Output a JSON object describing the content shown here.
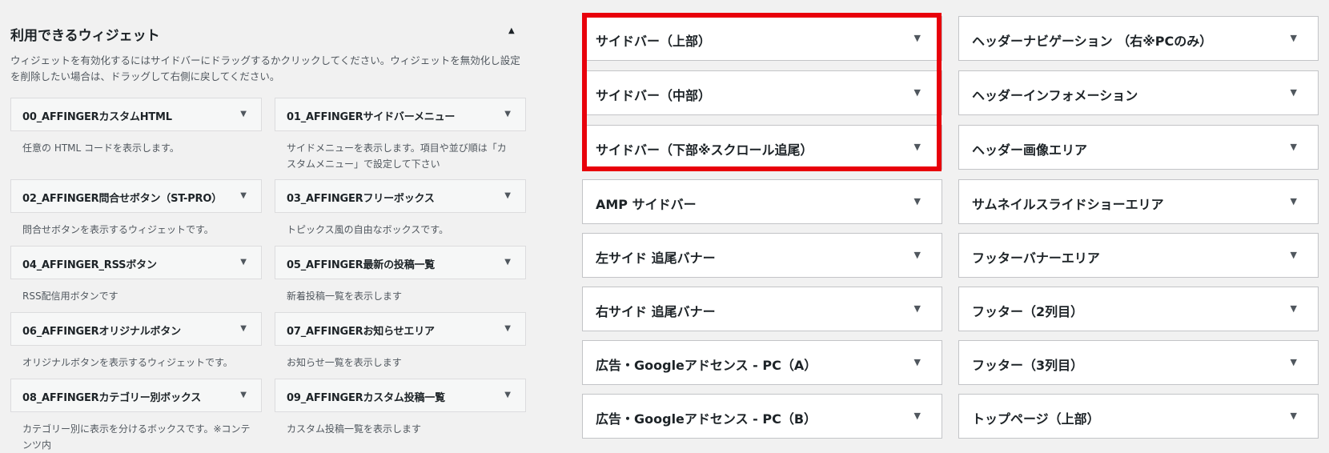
{
  "available": {
    "title": "利用できるウィジェット",
    "toggle": "▲",
    "description": "ウィジェットを有効化するにはサイドバーにドラッグするかクリックしてください。ウィジェットを無効化し設定を削除したい場合は、ドラッグして右側に戻してください。",
    "widgets": [
      {
        "label": "00_AFFINGERカスタムHTML",
        "desc": "任意の HTML コードを表示します。"
      },
      {
        "label": "01_AFFINGERサイドバーメニュー",
        "desc": "サイドメニューを表示します。項目や並び順は「カスタムメニュー」で設定して下さい"
      },
      {
        "label": "02_AFFINGER問合せボタン（ST-PRO）",
        "desc": "問合せボタンを表示するウィジェットです。"
      },
      {
        "label": "03_AFFINGERフリーボックス",
        "desc": "トピックス風の自由なボックスです。"
      },
      {
        "label": "04_AFFINGER_RSSボタン",
        "desc": "RSS配信用ボタンです"
      },
      {
        "label": "05_AFFINGER最新の投稿一覧",
        "desc": "新着投稿一覧を表示します"
      },
      {
        "label": "06_AFFINGERオリジナルボタン",
        "desc": "オリジナルボタンを表示するウィジェットです。"
      },
      {
        "label": "07_AFFINGERお知らせエリア",
        "desc": "お知らせ一覧を表示します"
      },
      {
        "label": "08_AFFINGERカテゴリー別ボックス",
        "desc": "カテゴリー別に表示を分けるボックスです。※コンテンツ内"
      },
      {
        "label": "09_AFFINGERカスタム投稿一覧",
        "desc": "カスタム投稿一覧を表示します"
      }
    ]
  },
  "arrow_glyph": "▼",
  "areas_left": [
    {
      "label": "サイドバー（上部）"
    },
    {
      "label": "サイドバー（中部）"
    },
    {
      "label": "サイドバー（下部※スクロール追尾）"
    },
    {
      "label": "AMP サイドバー"
    },
    {
      "label": "左サイド 追尾バナー"
    },
    {
      "label": "右サイド 追尾バナー"
    },
    {
      "label": "広告・Googleアドセンス - PC（A）"
    },
    {
      "label": "広告・Googleアドセンス - PC（B）"
    }
  ],
  "areas_right": [
    {
      "label": "ヘッダーナビゲーション （右※PCのみ）"
    },
    {
      "label": "ヘッダーインフォメーション"
    },
    {
      "label": "ヘッダー画像エリア"
    },
    {
      "label": "サムネイルスライドショーエリア"
    },
    {
      "label": "フッターバナーエリア"
    },
    {
      "label": "フッター（2列目）"
    },
    {
      "label": "フッター（3列目）"
    },
    {
      "label": "トップページ（上部）"
    }
  ],
  "colors": {
    "highlight": "#e8000b",
    "background": "#f1f1f1"
  }
}
